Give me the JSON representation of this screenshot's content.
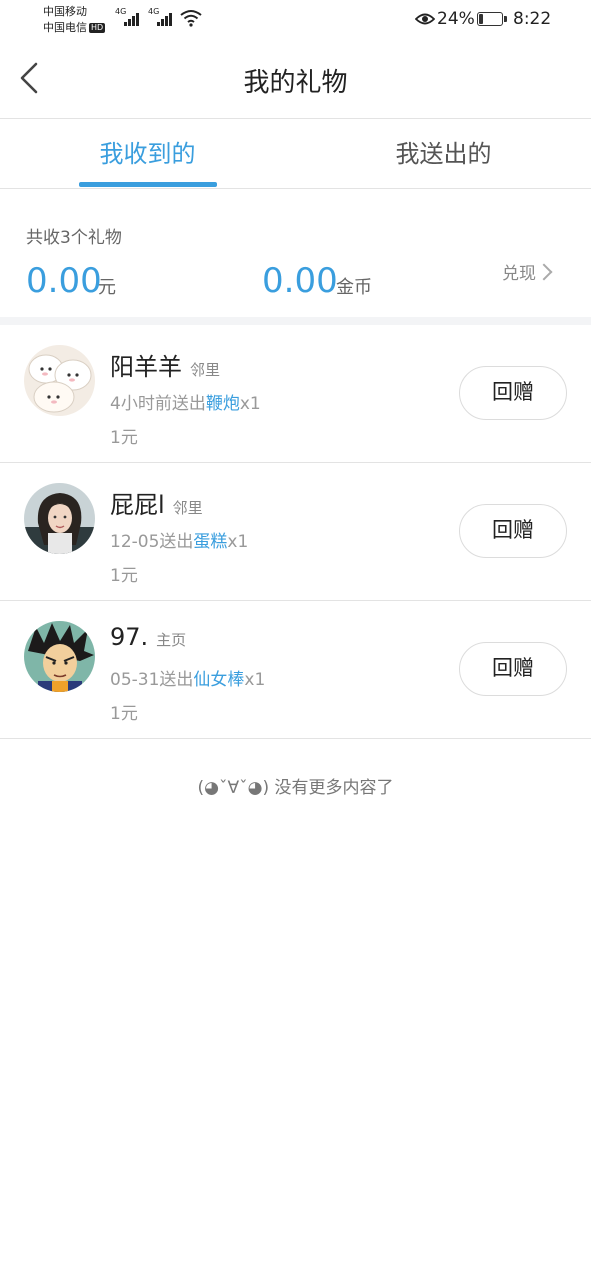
{
  "status_bar": {
    "carrier_1": "中国移动",
    "carrier_2": "中国电信",
    "hd_badge": "HD",
    "network_1": "4G",
    "network_2": "4G",
    "battery_percent": "24%",
    "time": "8:22",
    "battery_level": 0.24
  },
  "header": {
    "title": "我的礼物"
  },
  "tabs": [
    {
      "label": "我收到的",
      "active": true
    },
    {
      "label": "我送出的",
      "active": false
    }
  ],
  "summary": {
    "received_count_label": "共收3个礼物",
    "cash_amount": "0.00",
    "cash_unit": "元",
    "coin_amount": "0.00",
    "coin_unit": "金币",
    "withdraw_label": "兑现"
  },
  "gifts": [
    {
      "name": "阳羊羊",
      "tag": "邻里",
      "time_text": "4小时前送出",
      "gift_name": "鞭炮",
      "quantity": "x1",
      "value": "1元",
      "action_label": "回赠"
    },
    {
      "name": "屁屁l",
      "tag": "邻里",
      "time_text": "12-05送出",
      "gift_name": "蛋糕",
      "quantity": "x1",
      "value": "1元",
      "action_label": "回赠"
    },
    {
      "name": "97.",
      "tag": "主页",
      "time_text": "05-31送出",
      "gift_name": "仙女棒",
      "quantity": "x1",
      "value": "1元",
      "action_label": "回赠"
    }
  ],
  "footer": {
    "no_more_text": "(◕ˇ∀ˇ◕) 没有更多内容了"
  },
  "colors": {
    "accent": "#3a9ede",
    "divider": "#e3e3e3",
    "section_gap": "#f3f4f6"
  }
}
